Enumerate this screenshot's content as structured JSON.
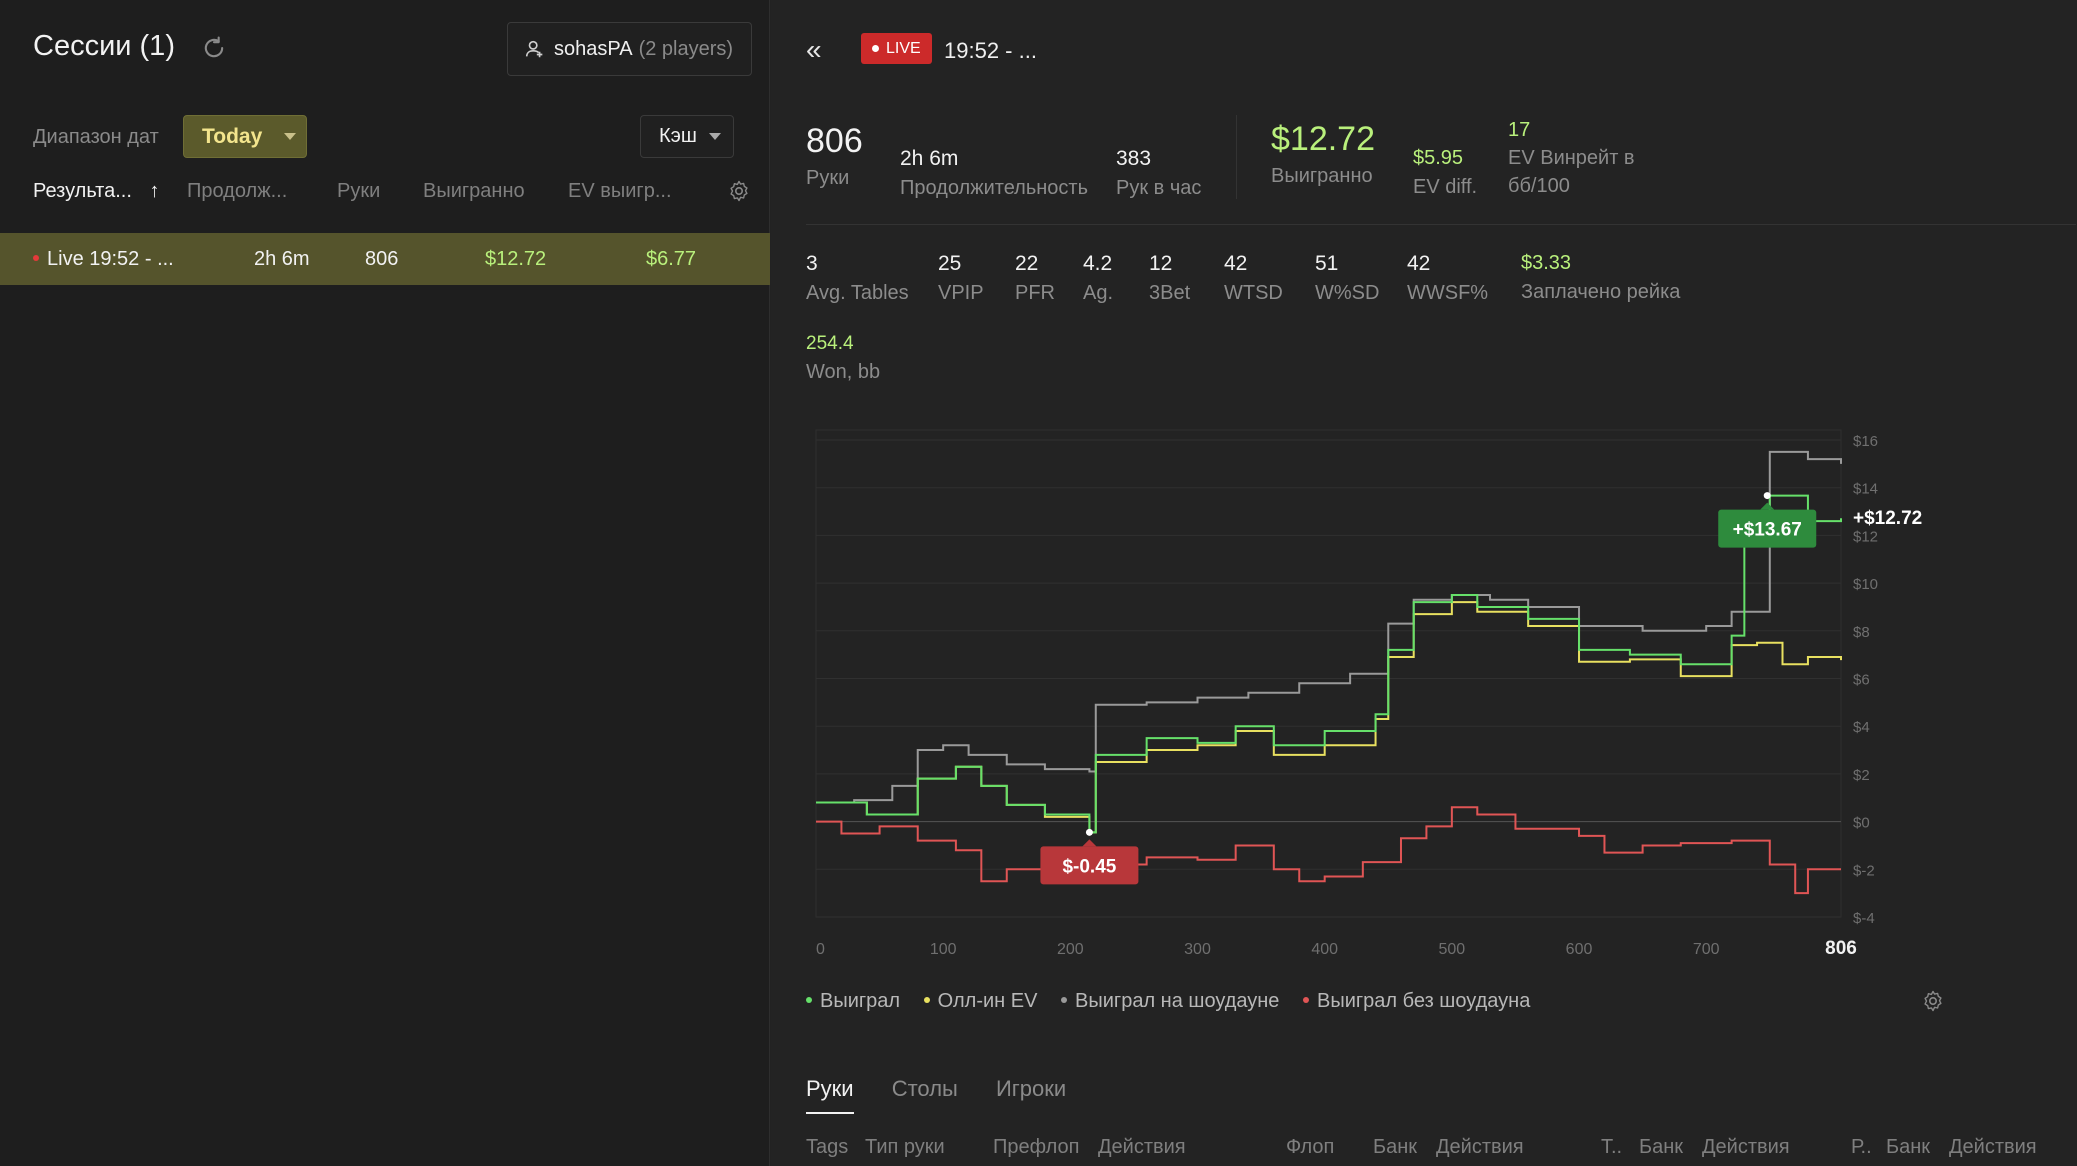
{
  "sessions": {
    "title": "Сессии (1)",
    "player_name": "sohasPA",
    "player_count": "(2 players)",
    "range_label": "Диапазон дат",
    "range_value": "Today",
    "game_type": "Кэш",
    "columns": [
      "Результа...",
      "Продолж...",
      "Руки",
      "Выигранно",
      "EV выигр..."
    ],
    "sort_arrow": "↑",
    "rows": [
      {
        "name": "Live 19:52 - ...",
        "duration": "2h 6m",
        "hands": "806",
        "won": "$12.72",
        "ev_won": "$6.77"
      }
    ]
  },
  "session": {
    "back": "«",
    "live_badge": "LIVE",
    "title": "19:52 - ...",
    "summary": {
      "hands_value": "806",
      "hands_label": "Руки",
      "duration_value": "2h 6m",
      "duration_label": "Продолжительность",
      "rate_value": "383",
      "rate_label": "Рук в час",
      "won_value": "$12.72",
      "won_label": "Выигранно",
      "evdiff_value": "$5.95",
      "evdiff_label": "EV diff.",
      "evwin_value": "17",
      "evwin_label": "EV Винрейт в бб/100"
    },
    "stats": [
      {
        "value": "3",
        "label": "Avg. Tables"
      },
      {
        "value": "25",
        "label": "VPIP"
      },
      {
        "value": "22",
        "label": "PFR"
      },
      {
        "value": "4.2",
        "label": "Ag."
      },
      {
        "value": "12",
        "label": "3Bet"
      },
      {
        "value": "42",
        "label": "WTSD"
      },
      {
        "value": "51",
        "label": "W%SD"
      },
      {
        "value": "42",
        "label": "WWSF%"
      },
      {
        "value": "$3.33",
        "label": "Заплачено рейка"
      }
    ],
    "won_bb": {
      "value": "254.4",
      "label": "Won, bb"
    }
  },
  "chart_data": {
    "type": "line",
    "xlim": [
      0,
      806
    ],
    "ylim": [
      -4,
      16
    ],
    "x_ticks": [
      "0",
      "100",
      "200",
      "300",
      "400",
      "500",
      "600",
      "700",
      "806"
    ],
    "y_ticks": [
      "$16",
      "$14",
      "$12",
      "$10",
      "$8",
      "$6",
      "$4",
      "$2",
      "$0",
      "$-2",
      "$-4"
    ],
    "grid": true,
    "legend_position": "bottom",
    "end_label": "+$12.72",
    "annotations": [
      {
        "label": "+$13.67",
        "x": 748,
        "y": 13.67,
        "color": "#2e8b3d"
      },
      {
        "label": "$-0.45",
        "x": 215,
        "y": -0.45,
        "color": "#b8373a"
      }
    ],
    "series": [
      {
        "name": "Выиграл",
        "color": "#66e06a",
        "x": [
          0,
          40,
          80,
          110,
          130,
          150,
          180,
          215,
          220,
          260,
          300,
          330,
          360,
          400,
          440,
          450,
          470,
          500,
          520,
          560,
          600,
          640,
          680,
          720,
          730,
          750,
          780,
          806
        ],
        "y": [
          0.8,
          0.3,
          1.8,
          2.3,
          1.5,
          0.7,
          0.3,
          -0.45,
          2.8,
          3.5,
          3.3,
          4.0,
          3.2,
          3.8,
          4.5,
          7.2,
          9.2,
          9.5,
          9.0,
          8.5,
          7.2,
          7.0,
          6.6,
          7.8,
          13.0,
          13.67,
          12.6,
          12.72
        ]
      },
      {
        "name": "Олл-ин EV",
        "color": "#e8e060",
        "x": [
          0,
          40,
          80,
          110,
          130,
          150,
          180,
          215,
          220,
          260,
          300,
          330,
          360,
          400,
          440,
          450,
          470,
          500,
          520,
          560,
          600,
          640,
          680,
          720,
          740,
          760,
          780,
          806
        ],
        "y": [
          0.8,
          0.3,
          1.8,
          2.3,
          1.5,
          0.7,
          0.2,
          -0.45,
          2.5,
          3.0,
          3.2,
          3.8,
          2.8,
          3.2,
          4.3,
          6.9,
          8.7,
          9.2,
          8.8,
          8.2,
          6.7,
          6.8,
          6.1,
          7.4,
          7.5,
          6.6,
          6.9,
          6.77
        ]
      },
      {
        "name": "Выиграл на шоудауне",
        "color": "#9a9a9a",
        "x": [
          0,
          30,
          60,
          80,
          100,
          120,
          150,
          180,
          215,
          220,
          260,
          300,
          340,
          380,
          420,
          450,
          470,
          500,
          530,
          560,
          600,
          650,
          700,
          720,
          750,
          780,
          806
        ],
        "y": [
          0.8,
          0.9,
          1.5,
          3.0,
          3.2,
          2.8,
          2.4,
          2.2,
          2.1,
          4.9,
          5.0,
          5.2,
          5.4,
          5.8,
          6.2,
          8.3,
          9.3,
          9.5,
          9.3,
          9.0,
          8.2,
          8.0,
          8.2,
          8.8,
          15.5,
          15.2,
          15.0
        ]
      },
      {
        "name": "Выиграл без шоудауна",
        "color": "#e05555",
        "x": [
          0,
          20,
          50,
          80,
          110,
          130,
          150,
          180,
          215,
          240,
          260,
          300,
          330,
          360,
          380,
          400,
          430,
          460,
          480,
          500,
          520,
          550,
          600,
          620,
          650,
          680,
          720,
          750,
          770,
          780,
          806
        ],
        "y": [
          0.0,
          -0.5,
          -0.2,
          -0.8,
          -1.2,
          -2.5,
          -2.0,
          -2.2,
          -2.4,
          -1.8,
          -1.5,
          -1.6,
          -1.0,
          -2.0,
          -2.5,
          -2.3,
          -1.7,
          -0.7,
          -0.2,
          0.6,
          0.3,
          -0.3,
          -0.6,
          -1.3,
          -1.0,
          -0.9,
          -0.8,
          -1.8,
          -3.0,
          -2.0,
          -2.0
        ]
      }
    ]
  },
  "chart_controls": {
    "gear": "gear-icon"
  },
  "tabs": [
    "Руки",
    "Столы",
    "Игроки"
  ],
  "hand_columns": [
    "Tags",
    "Тип руки",
    "Префлоп",
    "Действия",
    "Флоп",
    "Банк",
    "Действия",
    "Т..",
    "Банк",
    "Действия",
    "Р..",
    "Банк",
    "Действия"
  ]
}
